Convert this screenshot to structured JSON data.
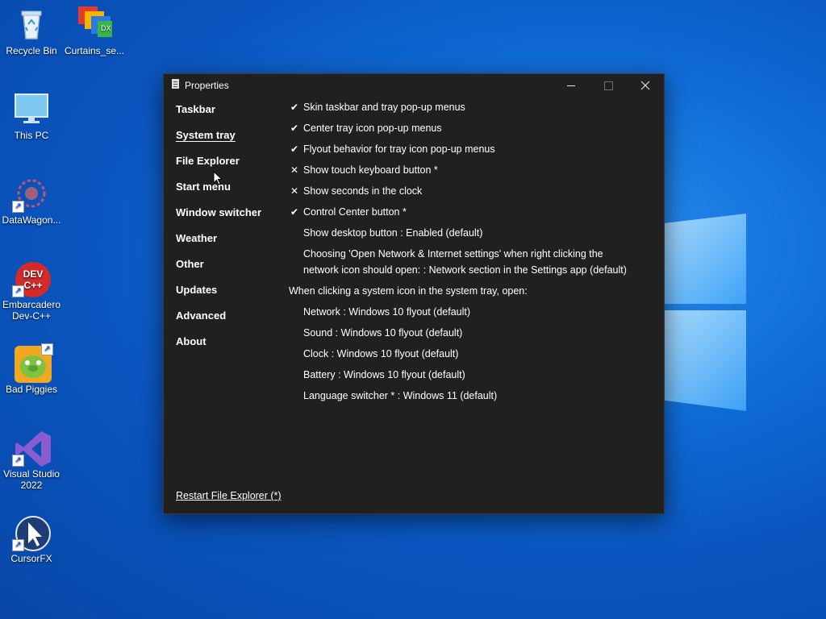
{
  "desktop": {
    "icons": [
      {
        "label": "Recycle Bin",
        "icon": "recycle-bin-icon"
      },
      {
        "label": "Curtains_se...",
        "icon": "curtains-icon"
      },
      {
        "label": "This PC",
        "icon": "monitor-icon"
      },
      {
        "label": "DataWagon...",
        "icon": "datawagon-icon"
      },
      {
        "label": "Embarcadero Dev-C++",
        "icon": "devcpp-icon",
        "icon_text": "DEV C++"
      },
      {
        "label": "Bad Piggies",
        "icon": "bad-piggies-icon"
      },
      {
        "label": "Visual Studio 2022",
        "icon": "visual-studio-icon"
      },
      {
        "label": "CursorFX",
        "icon": "cursorfx-icon"
      }
    ]
  },
  "window": {
    "title": "Properties",
    "nav": [
      {
        "label": "Taskbar",
        "active": false
      },
      {
        "label": "System tray",
        "active": true
      },
      {
        "label": "File Explorer",
        "active": false
      },
      {
        "label": "Start menu",
        "active": false
      },
      {
        "label": "Window switcher",
        "active": false
      },
      {
        "label": "Weather",
        "active": false
      },
      {
        "label": "Other",
        "active": false
      },
      {
        "label": "Updates",
        "active": false
      },
      {
        "label": "Advanced",
        "active": false
      },
      {
        "label": "About",
        "active": false
      }
    ],
    "options": [
      {
        "mark": "✔",
        "label": "Skin taskbar and tray pop-up menus"
      },
      {
        "mark": "✔",
        "label": "Center tray icon pop-up menus"
      },
      {
        "mark": "✔",
        "label": "Flyout behavior for tray icon pop-up menus"
      },
      {
        "mark": "✕",
        "label": "Show touch keyboard button *"
      },
      {
        "mark": "✕",
        "label": "Show seconds in the clock"
      },
      {
        "mark": "✔",
        "label": "Control Center button *"
      },
      {
        "mark": "",
        "label": "Show desktop button : Enabled (default)"
      },
      {
        "mark": "",
        "label": "Choosing 'Open Network & Internet settings' when right clicking the"
      },
      {
        "mark": "",
        "label": "network icon should open: : Network section in the Settings app (default)"
      }
    ],
    "section_header": "When clicking a system icon in the system tray, open:",
    "tray_options": [
      {
        "label": "Network : Windows 10 flyout (default)"
      },
      {
        "label": "Sound : Windows 10 flyout (default)"
      },
      {
        "label": "Clock : Windows 10 flyout (default)"
      },
      {
        "label": "Battery : Windows 10 flyout (default)"
      },
      {
        "label": "Language switcher * : Windows 11 (default)"
      }
    ],
    "restart_link": "Restart File Explorer (*)"
  },
  "colors": {
    "window_bg": "#202020",
    "desktop_bg": "#0f6bd6",
    "text": "#ffffff"
  }
}
